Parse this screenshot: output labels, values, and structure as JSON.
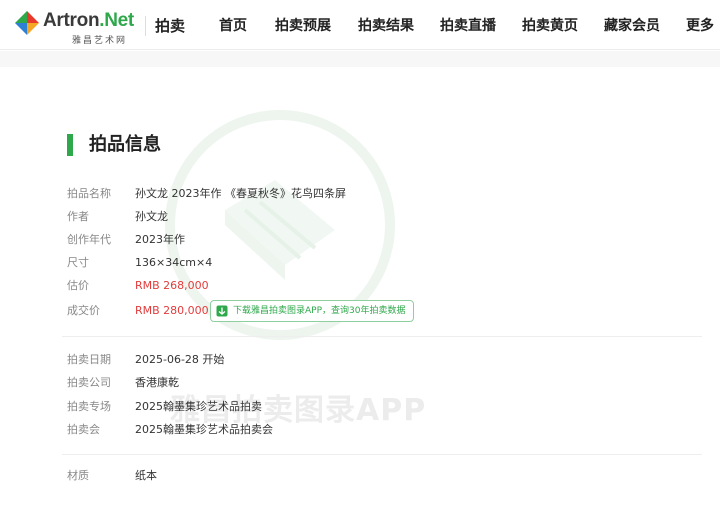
{
  "header": {
    "logo_main": "Artron",
    "logo_dot": ".Net",
    "logo_sub": "雅昌艺术网",
    "section": "拍卖",
    "nav": [
      {
        "label": "首页"
      },
      {
        "label": "拍卖预展"
      },
      {
        "label": "拍卖结果"
      },
      {
        "label": "拍卖直播"
      },
      {
        "label": "拍卖黄页"
      },
      {
        "label": "藏家会员"
      },
      {
        "label": "更多"
      }
    ]
  },
  "watermark": {
    "text": "雅昌拍卖图录APP"
  },
  "panel": {
    "title": "拍品信息",
    "rows": [
      {
        "label": "拍品名称",
        "value": "孙文龙 2023年作 《春夏秋冬》花鸟四条屏"
      },
      {
        "label": "作者",
        "value": "孙文龙"
      },
      {
        "label": "创作年代",
        "value": "2023年作"
      },
      {
        "label": "尺寸",
        "value": "136×34cm×4"
      },
      {
        "label": "估价",
        "value": "RMB 268,000"
      },
      {
        "label": "成交价",
        "value": "RMB 280,000"
      }
    ],
    "app_badge": "下载雅昌拍卖图录APP，查询30年拍卖数据",
    "auction_rows": [
      {
        "label": "拍卖日期",
        "value": "2025-06-28 开始"
      },
      {
        "label": "拍卖公司",
        "value": "香港康乾"
      },
      {
        "label": "拍卖专场",
        "value": "2025翰墨集珍艺术品拍卖"
      },
      {
        "label": "拍卖会",
        "value": "2025翰墨集珍艺术品拍卖会"
      }
    ],
    "material_row": {
      "label": "材质",
      "value": "纸本"
    }
  },
  "colors": {
    "accent_green": "#2ea84b",
    "price_red": "#e23c3c",
    "label_gray": "#888888"
  }
}
